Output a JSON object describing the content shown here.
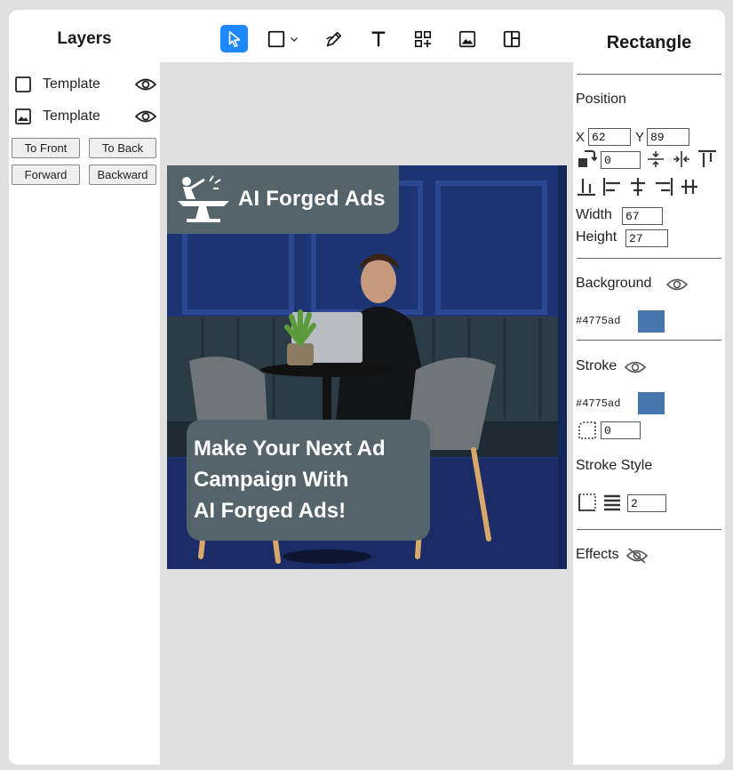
{
  "toolbar": {
    "tools": [
      "select-tool",
      "rectangle-tool",
      "draw-tool",
      "text-tool",
      "components-tool",
      "image-tool",
      "layout-tool"
    ]
  },
  "layers": {
    "title": "Layers",
    "items": [
      {
        "label": "Template",
        "icon": "square-icon"
      },
      {
        "label": "Template",
        "icon": "image-icon"
      }
    ],
    "buttons": {
      "to_front": "To Front",
      "to_back": "To Back",
      "forward": "Forward",
      "backward": "Backward"
    }
  },
  "canvas": {
    "logo_text": "AI Forged Ads",
    "cta_lines": [
      "Make Your Next Ad",
      "Campaign With",
      "AI Forged Ads!"
    ]
  },
  "inspector": {
    "title": "Rectangle",
    "position_label": "Position",
    "x_label": "X",
    "x_value": "62",
    "y_label": "Y",
    "y_value": "89",
    "rotation_value": "0",
    "width_label": "Width",
    "width_value": "67",
    "height_label": "Height",
    "height_value": "27",
    "background_label": "Background",
    "background_hex": "#4775ad",
    "stroke_label": "Stroke",
    "stroke_hex": "#4775ad",
    "stroke_radius_value": "0",
    "stroke_style_label": "Stroke Style",
    "stroke_width_value": "2",
    "effects_label": "Effects"
  },
  "colors": {
    "accent": "#1e88ff",
    "swatch": "#4775ad",
    "overlay": "#55646a"
  }
}
